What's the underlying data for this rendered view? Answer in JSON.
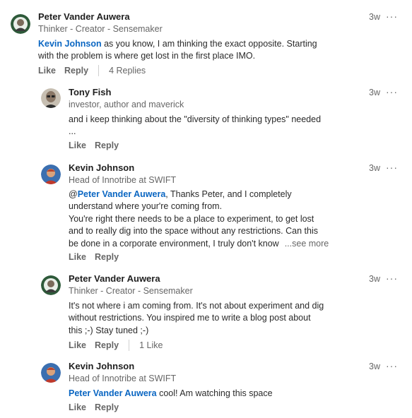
{
  "comments": [
    {
      "name": "Peter Vander Auwera",
      "headline": "Thinker - Creator - Sensemaker",
      "time": "3w",
      "more": "···",
      "mention": "Kevin Johnson",
      "text_line1": " as you know, I am thinking the exact opposite. Starting",
      "text_line2": "with the problem is where get lost in the first place IMO.",
      "like": "Like",
      "reply": "Reply",
      "replies_count": "4 Replies"
    },
    {
      "name": "Tony Fish",
      "headline": "investor, author and maverick",
      "time": "3w",
      "more": "···",
      "text_line1": "and i keep thinking about the \"diversity of thinking types\" needed",
      "text_line2": "...",
      "like": "Like",
      "reply": "Reply"
    },
    {
      "name": "Kevin Johnson",
      "headline": "Head of Innotribe at SWIFT",
      "time": "3w",
      "more": "···",
      "at": "@",
      "mention": "Peter Vander Auwera",
      "text_line1": ", Thanks Peter, and I completely",
      "text_line2": "understand where your're coming from.",
      "text_line3": "You're right there needs to be a place to experiment, to get lost",
      "text_line4": "and to really dig into the space without any restrictions. Can this",
      "text_line5": "be done in a corporate environment, I truly don't know",
      "see_more": "...see more",
      "like": "Like",
      "reply": "Reply"
    },
    {
      "name": "Peter Vander Auwera",
      "headline": "Thinker - Creator - Sensemaker",
      "time": "3w",
      "more": "···",
      "text_line1": "It's not where i am coming from. It's not about experiment and dig",
      "text_line2": "without restrictions. You inspired me to write a blog post about",
      "text_line3": "this ;-) Stay tuned ;-)",
      "like": "Like",
      "reply": "Reply",
      "likes_count": "1 Like"
    },
    {
      "name": "Kevin Johnson",
      "headline": "Head of Innotribe at SWIFT",
      "time": "3w",
      "more": "···",
      "mention": "Peter Vander Auwera",
      "text_line1": " cool! Am watching this space",
      "like": "Like",
      "reply": "Reply"
    }
  ]
}
